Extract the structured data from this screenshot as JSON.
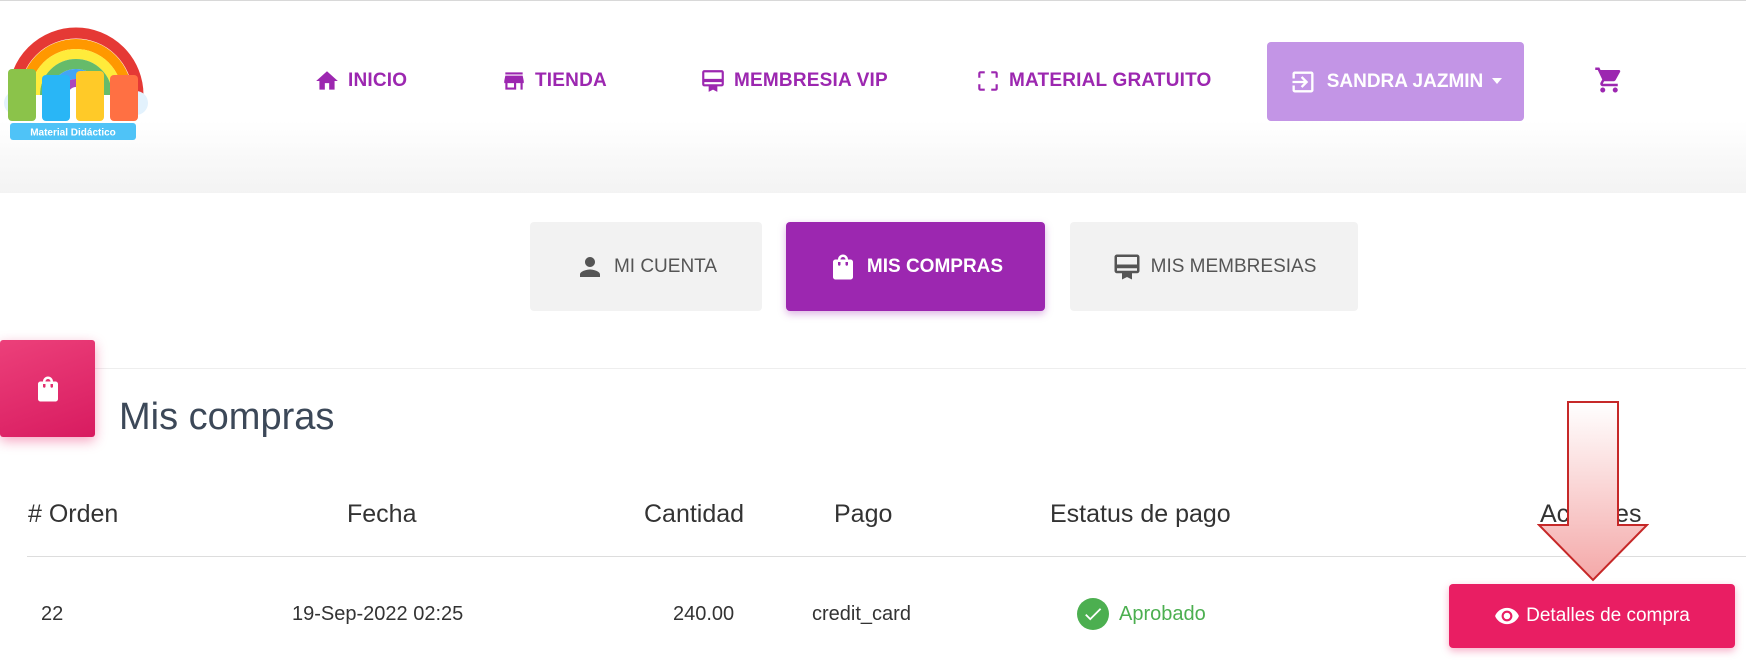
{
  "header": {
    "logo_text": "Material Didáctico",
    "nav": [
      {
        "label": "INICIO",
        "icon": "home-icon"
      },
      {
        "label": "TIENDA",
        "icon": "store-icon"
      },
      {
        "label": "MEMBRESIA VIP",
        "icon": "card-membership-icon"
      },
      {
        "label": "MATERIAL GRATUITO",
        "icon": "crop-free-icon"
      }
    ],
    "user": {
      "label": "SANDRA JAZMIN",
      "icon": "logout-icon"
    },
    "cart_icon": "shopping-cart-icon"
  },
  "tabs": [
    {
      "label": "MI CUENTA",
      "icon": "person-icon",
      "active": false
    },
    {
      "label": "MIS COMPRAS",
      "icon": "shopping-bag-icon",
      "active": true
    },
    {
      "label": "MIS MEMBRESIAS",
      "icon": "card-membership-icon",
      "active": false
    }
  ],
  "card": {
    "title": "Mis compras",
    "icon": "shopping-bag-icon"
  },
  "table": {
    "headers": [
      "# Orden",
      "Fecha",
      "Cantidad",
      "Pago",
      "Estatus de pago",
      "Acciones"
    ],
    "rows": [
      {
        "order": "22",
        "date": "19-Sep-2022 02:25",
        "amount": "240.00",
        "payment": "credit_card",
        "status": "Aprobado",
        "action": "Detalles de compra"
      }
    ]
  },
  "colors": {
    "primary": "#9c27b0",
    "user_button": "#c395e6",
    "accent": "#e91e63",
    "success": "#4caf50"
  }
}
